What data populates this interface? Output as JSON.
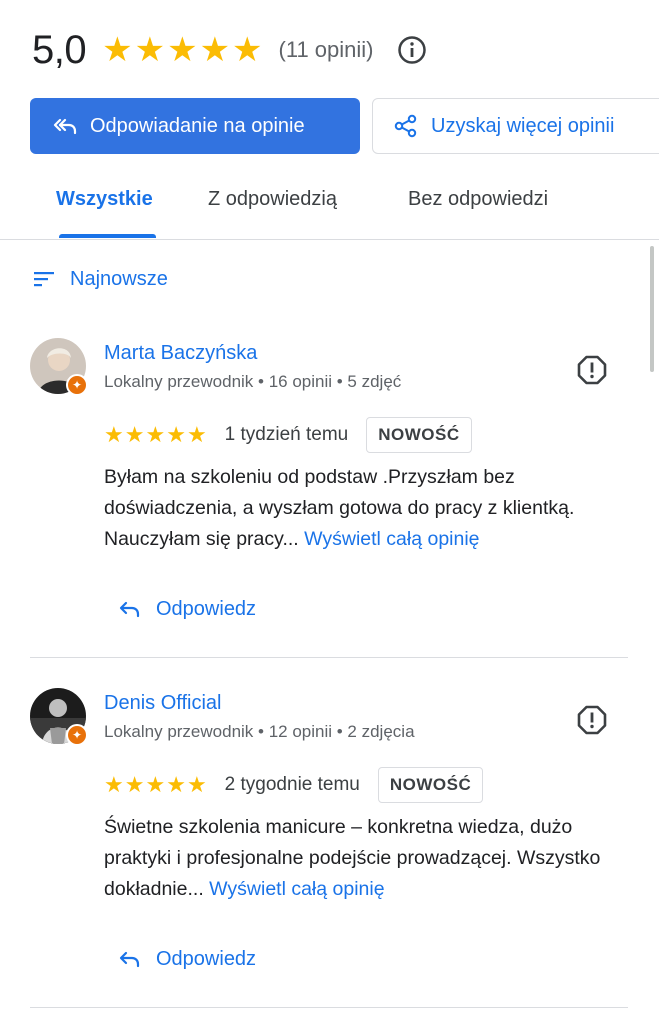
{
  "summary": {
    "rating": "5,0",
    "stars": 5,
    "count_text": "(11 opinii)"
  },
  "actions": {
    "primary_label": "Odpowiadanie na opinie",
    "secondary_label": "Uzyskaj więcej opinii"
  },
  "tabs": [
    {
      "label": "Wszystkie",
      "active": true
    },
    {
      "label": "Z odpowiedzią",
      "active": false
    },
    {
      "label": "Bez odpowiedzi",
      "active": false
    }
  ],
  "sort": {
    "label": "Najnowsze"
  },
  "reviews": [
    {
      "author": "Marta Baczyńska",
      "meta": "Lokalny przewodnik • 16 opinii • 5 zdjęć",
      "rating": 5,
      "time": "1 tydzień temu",
      "badge": "NOWOŚĆ",
      "text": "Byłam na szkoleniu od podstaw .Przyszłam bez doświadczenia, a wyszłam gotowa do pracy z klientką. Nauczyłam się pracy...",
      "more_label": "Wyświetl całą opinię",
      "reply_label": "Odpowiedz"
    },
    {
      "author": "Denis Official",
      "meta": "Lokalny przewodnik • 12 opinii • 2 zdjęcia",
      "rating": 5,
      "time": "2 tygodnie temu",
      "badge": "NOWOŚĆ",
      "text": "Świetne szkolenia manicure – konkretna wiedza, dużo praktyki i profesjonalne podejście prowadzącej. Wszystko dokładnie...",
      "more_label": "Wyświetl całą opinię",
      "reply_label": "Odpowiedz"
    }
  ],
  "colors": {
    "accent": "#1a73e8",
    "primary_button": "#3273e0",
    "star": "#fbbc04",
    "local_guide_badge": "#e8710a"
  }
}
